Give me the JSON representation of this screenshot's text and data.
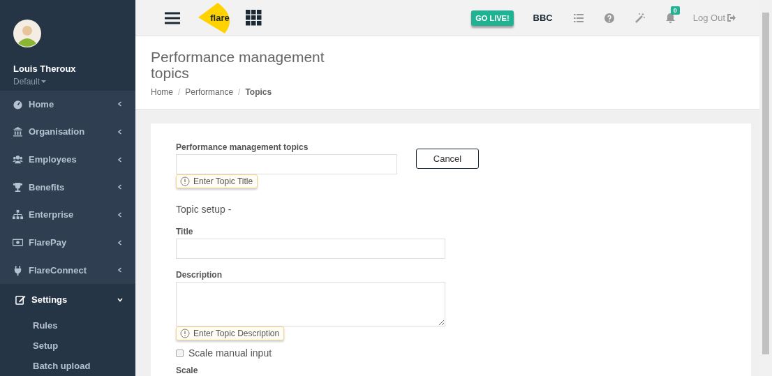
{
  "user": {
    "name": "Louis Theroux",
    "role": "Default"
  },
  "nav": [
    {
      "label": "Home",
      "kind": "gauge",
      "expanded": false
    },
    {
      "label": "Organisation",
      "kind": "bank",
      "expanded": false
    },
    {
      "label": "Employees",
      "kind": "users",
      "expanded": false
    },
    {
      "label": "Benefits",
      "kind": "trophy",
      "expanded": false
    },
    {
      "label": "Enterprise",
      "kind": "sitemap",
      "expanded": false
    },
    {
      "label": "FlarePay",
      "kind": "money",
      "expanded": false
    },
    {
      "label": "FlareConnect",
      "kind": "plug",
      "expanded": false
    },
    {
      "label": "Settings",
      "kind": "edit",
      "expanded": true,
      "children": [
        {
          "label": "Rules"
        },
        {
          "label": "Setup"
        },
        {
          "label": "Batch upload"
        }
      ]
    }
  ],
  "header": {
    "logo": "flare",
    "go_live": "GO LIVE!",
    "company": "BBC",
    "notifications": "0",
    "logout": "Log Out"
  },
  "page": {
    "title": "Performance management topics",
    "separator": "/",
    "breadcrumb": [
      {
        "label": "Home",
        "selected": false
      },
      {
        "label": "Performance",
        "selected": false
      },
      {
        "label": "Topics",
        "selected": true
      }
    ]
  },
  "form": {
    "topics_label": "Performance management topics",
    "topics_tooltip": "Enter Topic Title",
    "cancel": "Cancel",
    "section": "Topic setup -",
    "title_label": "Title",
    "description_label": "Description",
    "description_tooltip": "Enter Topic Description",
    "options": [
      {
        "label": "Scale manual input",
        "checked": false
      }
    ],
    "scale_label": "Scale"
  }
}
